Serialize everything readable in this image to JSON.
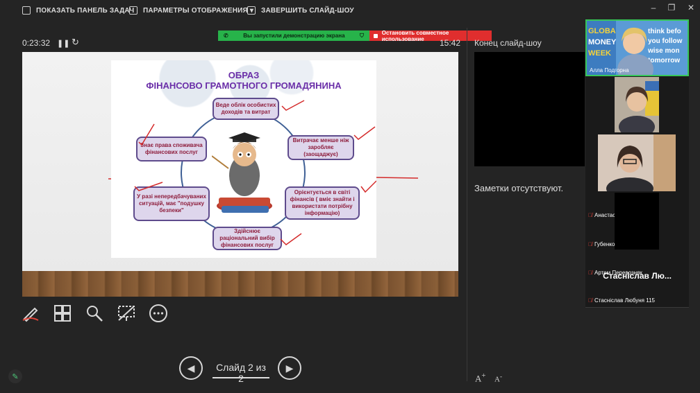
{
  "toolbar": {
    "taskbar_label": "ПОКАЗАТЬ ПАНЕЛЬ ЗАДАЧ",
    "display_settings_label": "ПАРАМЕТРЫ ОТОБРАЖЕНИЯ ▾",
    "end_slideshow_label": "ЗАВЕРШИТЬ СЛАЙД-ШОУ"
  },
  "share_banner": {
    "active_text": "Вы запустили демонстрацию экрана",
    "stop_text": "Остановить совместное использование"
  },
  "timer": "0:23:32",
  "clock": "15:42",
  "next_slide_title": "Конец слайд-шоу",
  "notes_text": "Заметки отсутствуют.",
  "slide": {
    "title_line1": "ОБРАЗ",
    "title_line2": "ФІНАНСОВО ГРАМОТНОГО ГРОМАДЯНИНА",
    "boxes": [
      "Веде облік особистих доходів та витрат",
      "Витрачає менше ніж заробляє (заощаджує)",
      "Орієнтується в світі фінансів ( вміє знайти і використати потрібну інформацію)",
      "Здійснює раціональний вибір фінансових послуг",
      "У разі непередбачуваних ситуацій, має \"подушку безпеки\"",
      "Знає права споживача фінансових послуг"
    ]
  },
  "navigation": {
    "counter": "Слайд 2 из 2"
  },
  "participants": [
    {
      "name": "Алла Подгорна",
      "muted": false,
      "banner": "GLOBAL MONEY WEEK · think before you follow · wise money tomorrow"
    },
    {
      "name": "Анастасія Михайленко",
      "muted": true
    },
    {
      "name": "Губенко Катерина",
      "muted": true
    },
    {
      "name": "Артем Перевозняк",
      "muted": true
    },
    {
      "name": "Стасніслав Любуня 115",
      "muted": true,
      "display_name": "Стасніслав Лю..."
    }
  ],
  "colors": {
    "speaker_border": "#37c65a",
    "banner_green": "#27b34a",
    "banner_red": "#e02e2e",
    "slide_title": "#6a2ea8",
    "box_text": "#8e1d3c"
  }
}
